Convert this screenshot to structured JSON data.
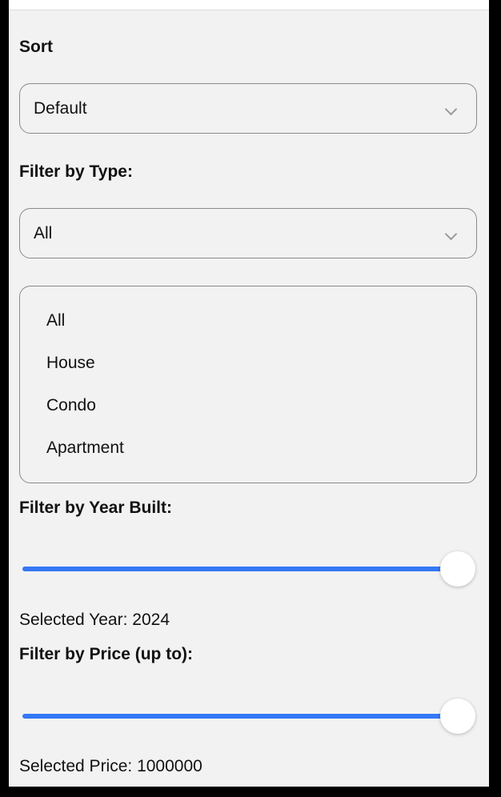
{
  "sort": {
    "label": "Sort",
    "selected": "Default"
  },
  "type_filter": {
    "label": "Filter by Type:",
    "selected": "All",
    "options": [
      "All",
      "House",
      "Condo",
      "Apartment"
    ]
  },
  "year_filter": {
    "label": "Filter by Year Built:",
    "readout": "Selected Year: 2024",
    "level": 1.0
  },
  "price_filter": {
    "label": "Filter by Price (up to):",
    "readout": "Selected Price: 1000000",
    "level": 1.0
  },
  "colors": {
    "accent": "#3478f6",
    "background": "#f2f2f2"
  }
}
